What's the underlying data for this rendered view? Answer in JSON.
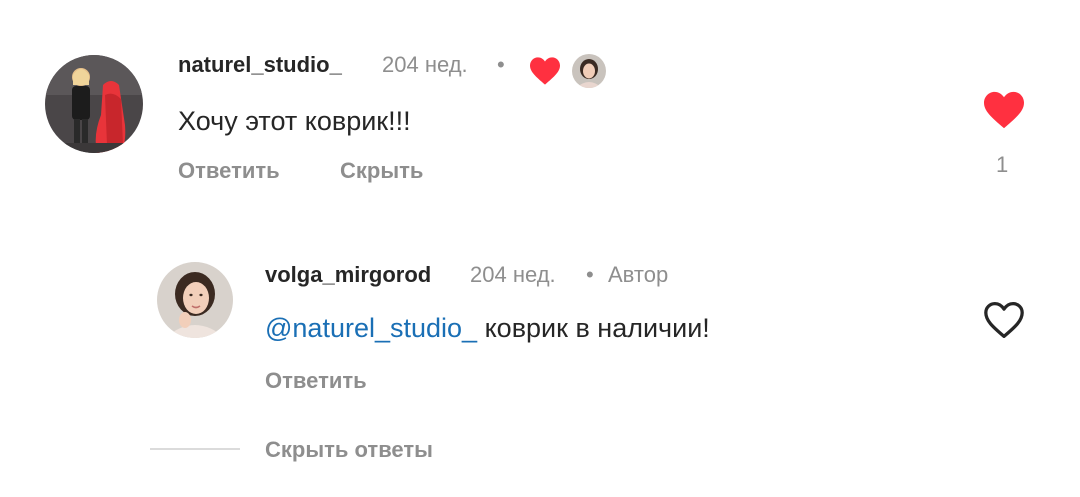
{
  "comment": {
    "username": "naturel_studio_",
    "time": "204 нед.",
    "separator": "•",
    "text": "Хочу этот коврик!!!",
    "reply_label": "Ответить",
    "hide_label": "Скрыть",
    "like_count": "1",
    "liked": true
  },
  "reply": {
    "username": "volga_mirgorod",
    "time": "204 нед.",
    "separator": "•",
    "author_badge": "Автор",
    "mention": "@naturel_studio_",
    "text": "коврик в наличии!",
    "reply_label": "Ответить",
    "liked": false
  },
  "hide_replies_label": "Скрыть ответы",
  "colors": {
    "like_red": "#ff3040",
    "mention_blue": "#1a6fb5",
    "muted": "#8e8e8e",
    "text": "#262626"
  },
  "icons": {
    "liked_by_author": "heart-filled-icon",
    "like": "heart-filled-icon",
    "unlike": "heart-outline-icon"
  }
}
